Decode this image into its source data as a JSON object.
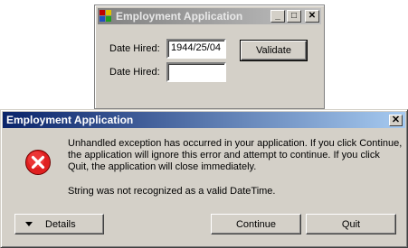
{
  "background_window": {
    "title": "Employment Application",
    "minimize_glyph": "_",
    "maximize_glyph": "□",
    "close_glyph": "✕",
    "date_hired_label_1": "Date Hired:",
    "date_hired_value": "1944/25/04",
    "date_hired_label_2": "Date Hired:",
    "date_hired_value_2": "",
    "validate_button": "Validate"
  },
  "dialog": {
    "title": "Employment Application",
    "close_glyph": "✕",
    "icon": "error-icon",
    "message_line": "Unhandled exception has occurred in your application. If you click Continue, the application will ignore this error and attempt to continue. If you click Quit, the application will close immediately.",
    "detail_line": "String was not recognized as a valid DateTime.",
    "details_button": "Details",
    "continue_button": "Continue",
    "quit_button": "Quit"
  },
  "colors": {
    "dialog_titlebar_start": "#0a246a",
    "dialog_titlebar_end": "#a6caf0",
    "inactive_titlebar": "#808080",
    "error_icon_red": "#e02020"
  }
}
